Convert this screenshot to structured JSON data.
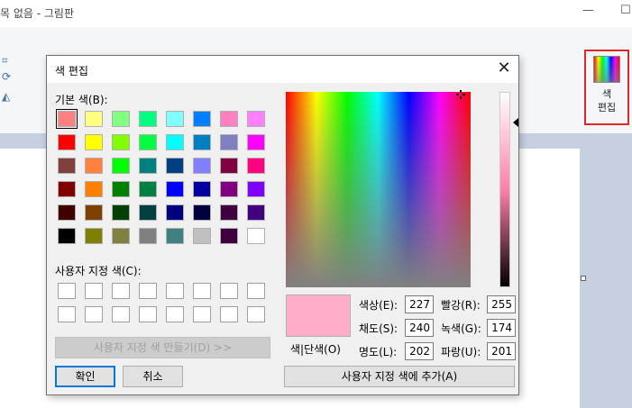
{
  "paint": {
    "window_title": "제목 없음 - 그림판",
    "title_visible": "목 없음 - 그림판",
    "minimize_glyph": "—",
    "maximize_glyph": "☐",
    "edit_colors_label": "색\n편집",
    "palette_row1": [
      "#c8c8c8",
      "#e0e0e0",
      "#d8d8d8",
      "#d0d0d0",
      "#22b14c",
      "#00a2e8",
      "#3f48cc",
      "#a349a4"
    ],
    "palette_row2": [
      "#f8f8f8",
      "#f0f0f0",
      "#f0f0f0",
      "#f0f0f0",
      "#b5e61d",
      "#99d9ea",
      "#7092be",
      "#c8bfe7"
    ]
  },
  "dialog": {
    "title": "색 편집",
    "close_glyph": "✕",
    "basic_colors_label": "기본 색(B):",
    "basic_colors": [
      [
        "#ff8080",
        "#ffff80",
        "#80ff80",
        "#00ff80",
        "#80ffff",
        "#0080ff",
        "#ff80c0",
        "#ff80ff"
      ],
      [
        "#ff0000",
        "#ffff00",
        "#80ff00",
        "#00ff40",
        "#00ffff",
        "#0080c0",
        "#8080c0",
        "#ff00ff"
      ],
      [
        "#804040",
        "#ff8040",
        "#00ff00",
        "#008080",
        "#004080",
        "#8080ff",
        "#800040",
        "#ff0080"
      ],
      [
        "#800000",
        "#ff8000",
        "#008000",
        "#008040",
        "#0000ff",
        "#0000a0",
        "#800080",
        "#8000ff"
      ],
      [
        "#400000",
        "#804000",
        "#004000",
        "#004040",
        "#000080",
        "#000040",
        "#400040",
        "#400080"
      ],
      [
        "#000000",
        "#808000",
        "#808040",
        "#808080",
        "#408080",
        "#c0c0c0",
        "#400040",
        "#ffffff"
      ]
    ],
    "custom_colors_label": "사용자 지정 색(C):",
    "define_custom_button": "사용자 지정 색 만들기(D) >>",
    "ok_button": "확인",
    "cancel_button": "취소",
    "preview_label": "색|단색(O)",
    "preview_color": "#ffaec9",
    "hue_label": "색상(E):",
    "hue_value": "227",
    "sat_label": "채도(S):",
    "sat_value": "240",
    "lum_label": "명도(L):",
    "lum_value": "202",
    "red_label": "빨강(R):",
    "red_value": "255",
    "green_label": "녹색(G):",
    "green_value": "174",
    "blue_label": "파랑(U):",
    "blue_value": "201",
    "add_custom_button": "사용자 지정 색에 추가(A)"
  }
}
